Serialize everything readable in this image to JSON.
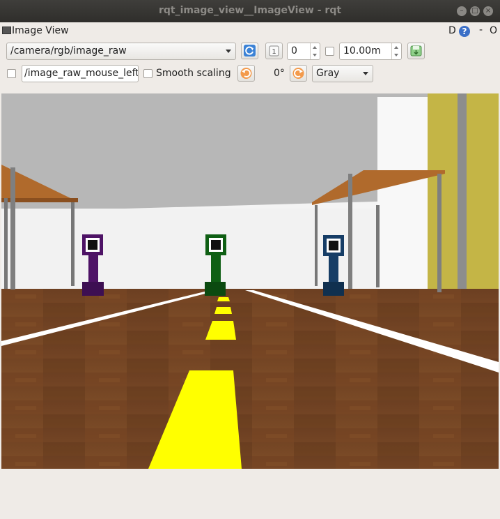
{
  "window": {
    "title": "rqt_image_view__ImageView - rqt",
    "buttons": {
      "minimize": "–",
      "maximize": "□",
      "close": "×"
    }
  },
  "panel": {
    "title": "Image View",
    "dock_label": "D",
    "help_label": "?",
    "minimize_label": "-",
    "close_label": "O"
  },
  "toolbar": {
    "topic": "/camera/rgb/image_raw",
    "refresh_icon": "refresh-icon",
    "zoom_icon": "zoom-1-icon",
    "zoom_value": "0",
    "dynamic_range_checked": false,
    "max_range": "10.00m",
    "save_icon": "save-icon",
    "mouse_topic_checked": false,
    "mouse_topic": "/image_raw_mouse_left",
    "smooth_scaling_checked": false,
    "smooth_scaling_label": "Smooth scaling",
    "rotate_left_icon": "rotate-left-icon",
    "rotation": "0°",
    "rotate_right_icon": "rotate-right-icon",
    "color_scheme": "Gray"
  },
  "image": {
    "description": "",
    "colors": {
      "sky": "#b7b7b7",
      "wall": "#f6f6f6",
      "floor": "#6e3f1f",
      "lane_yellow": "#ffff00",
      "lane_white": "#ffffff",
      "marker_purple": "#4e1366",
      "marker_green": "#0f5f14",
      "marker_blue": "#163d66",
      "wall_yellow": "#c4b546"
    }
  }
}
